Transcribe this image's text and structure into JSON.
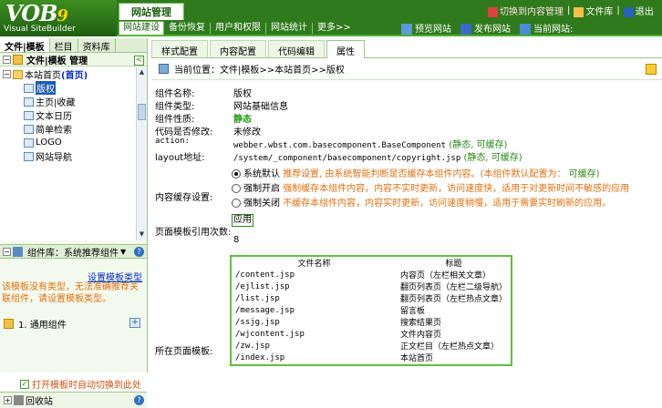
{
  "app": {
    "logo_main": "VOB",
    "logo_nine": "9",
    "logo_sub": "Visual SiteBuilder",
    "active_tab": "网站管理"
  },
  "subnav": [
    "网站建设",
    "备份恢复",
    "用户和权限",
    "网站统计",
    "更多>>"
  ],
  "top_links": {
    "switch_content": "切换到内容管理",
    "library": "文件库",
    "exit": "退出"
  },
  "top_actions": {
    "preview": "预览网站",
    "publish": "发布网站",
    "current_site": "当前网站:"
  },
  "left": {
    "tabs": [
      "文件|模板",
      "栏目",
      "资料库"
    ],
    "title": "文件|模板 管理",
    "tree": {
      "root": "本站首页",
      "root_tag": "(首页)",
      "items": [
        "版权",
        "主页|收藏",
        "文本日历",
        "简单检索",
        "LOGO",
        "网站导航"
      ]
    },
    "component_lib": "组件库：系统推荐组件",
    "set_template_type": "设置模板类型",
    "warning": "该模板没有类型，无法准确推荐关联组件，请设置模板类型。",
    "common_item": "1. 通用组件",
    "auto_switch": "打开模板时自动切换到此处",
    "recycle": "回收站"
  },
  "main": {
    "tabs": [
      "样式配置",
      "内容配置",
      "代码编辑",
      "属性"
    ],
    "breadcrumb": "当前位置：文件|模板>>本站首页>>版权",
    "props": {
      "name_label": "组件名称:",
      "name_value": "版权",
      "type_label": "组件类型:",
      "type_value": "网站基础信息",
      "nature_label": "组件性质:",
      "nature_value": "静态",
      "modified_label": "代码是否修改:",
      "modified_value": "未修改",
      "action_label": "action:",
      "action_value": "webber.wbst.com.basecomponent.BaseComponent",
      "action_tag_static": "(静态,",
      "action_tag_cache": "可缓存)",
      "layout_label": "layout地址:",
      "layout_value": "/system/_component/basecomponent/copyright.jsp",
      "layout_tag_static": "(静态,",
      "layout_tag_cache": "可缓存)",
      "cache_label": "内容缓存设置:",
      "opt1_title": "系统默认",
      "opt1_desc": "推荐设置, 由系统智能判断是否缓存本组件内容。(本组件默认配置为：",
      "opt1_tag": "可缓存)",
      "opt2_title": "强制开启",
      "opt2_desc": "强制缓存本组件内容，内容不实时更新，访问速度快，适用于对更新时间不敏感的应用",
      "opt3_title": "强制关闭",
      "opt3_desc": "不缓存本组件内容，内容实时更新，访问速度稍慢，适用于需要实时刷新的应用。",
      "apply": "应用",
      "refcount_label": "页面模板引用次数:",
      "refcount_value": "8",
      "pages_label": "所在页面模板:"
    },
    "file_table": {
      "headers": [
        "文件名称",
        "标题"
      ],
      "rows": [
        [
          "/content.jsp",
          "内容页（左栏相关文章）"
        ],
        [
          "/ejlist.jsp",
          "翻页列表页（左栏二级导航）"
        ],
        [
          "/list.jsp",
          "翻页列表页（左栏热点文章）"
        ],
        [
          "/message.jsp",
          "留言板"
        ],
        [
          "/ssjg.jsp",
          "搜索结果页"
        ],
        [
          "/wjcontent.jsp",
          "文件内容页"
        ],
        [
          "/zw.jsp",
          "正文栏目（左栏热点文章）"
        ],
        [
          "/index.jsp",
          "本站首页"
        ]
      ]
    }
  }
}
